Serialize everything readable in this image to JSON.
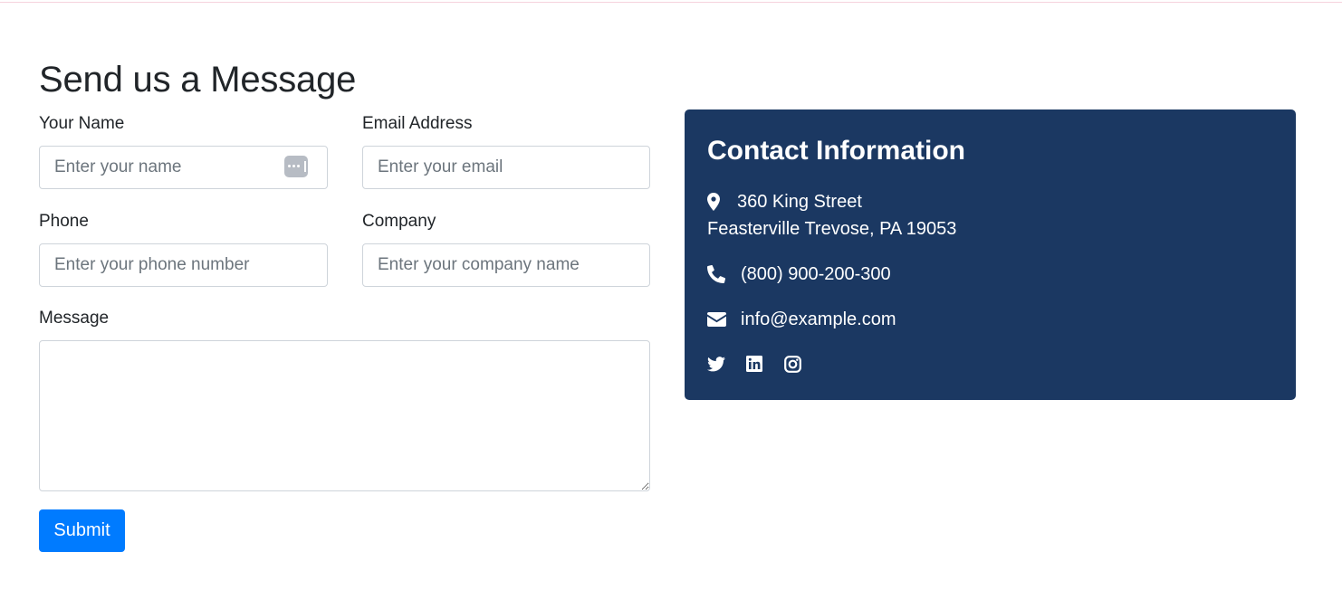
{
  "form": {
    "title": "Send us a Message",
    "name": {
      "label": "Your Name",
      "placeholder": "Enter your name"
    },
    "email": {
      "label": "Email Address",
      "placeholder": "Enter your email"
    },
    "phone": {
      "label": "Phone",
      "placeholder": "Enter your phone number"
    },
    "company": {
      "label": "Company",
      "placeholder": "Enter your company name"
    },
    "message": {
      "label": "Message",
      "placeholder": ""
    },
    "submit_label": "Submit",
    "accent_color": "#007bff"
  },
  "contact": {
    "title": "Contact Information",
    "background_color": "#1b3862",
    "address_line1": "360 King Street",
    "address_line2": "Feasterville Trevose, PA 19053",
    "phone": "(800) 900-200-300",
    "email": "info@example.com",
    "icons": {
      "address": "map-marker-icon",
      "phone": "phone-icon",
      "email": "envelope-icon"
    },
    "social": [
      "twitter-icon",
      "linkedin-icon",
      "instagram-icon"
    ]
  }
}
